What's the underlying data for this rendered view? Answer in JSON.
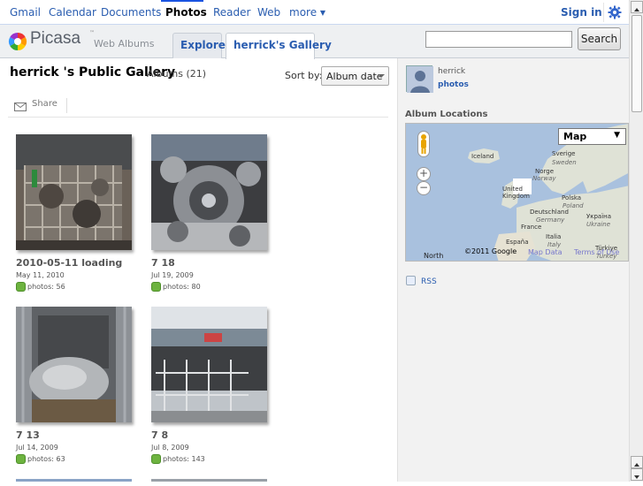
{
  "gbar": {
    "items": [
      {
        "label": "Gmail",
        "selected": false
      },
      {
        "label": "Calendar",
        "selected": false
      },
      {
        "label": "Documents",
        "selected": false
      },
      {
        "label": "Photos",
        "selected": true
      },
      {
        "label": "Reader",
        "selected": false
      },
      {
        "label": "Web",
        "selected": false
      },
      {
        "label": "more",
        "selected": false
      }
    ],
    "signin": "Sign in",
    "settings_icon": "gear-icon"
  },
  "header": {
    "logo_word": "Picasa",
    "logo_tm": "™",
    "logo_sub": "Web Albums",
    "tabs": [
      {
        "label": "Explore",
        "active": false
      },
      {
        "label": "herrick's Gallery",
        "active": true
      }
    ],
    "search_value": "",
    "search_button": "Search"
  },
  "gallery": {
    "title": "herrick 's Public Gallery",
    "subtitle": "Albums (21)",
    "sort_label": "Sort by:",
    "sort_value": "Album date",
    "share_label": "Share",
    "albums": [
      {
        "title": "2010-05-11 loading",
        "date": "May 11, 2010",
        "count": "photos: 56"
      },
      {
        "title": "7  18",
        "date": "Jul 19, 2009",
        "count": "photos: 80"
      },
      {
        "title": "7  13",
        "date": "Jul 14, 2009",
        "count": "photos: 63"
      },
      {
        "title": "7  8",
        "date": "Jul 8, 2009",
        "count": "photos: 143"
      }
    ]
  },
  "sidebar": {
    "user_name": "herrick",
    "user_photos": "photos",
    "locations_label": "Album Locations",
    "map": {
      "type_label": "Map",
      "copyright": "©2011 Google",
      "map_data": "Map Data",
      "terms": "Terms of Use",
      "labels": [
        "Iceland",
        "Sverige",
        "Sweden",
        "Norge",
        "Norway",
        "United Kingdom",
        "Polska",
        "Poland",
        "Deutschland",
        "Germany",
        "Україна",
        "Ukraine",
        "France",
        "Italia",
        "Italy",
        "España",
        "North",
        "Türkiye",
        "Turkey"
      ]
    },
    "rss": "RSS"
  },
  "colors": {
    "link": "#2a5db0",
    "panel": "#f2f2f2",
    "water": "#a9c1de",
    "land": "#dfe2d6"
  }
}
